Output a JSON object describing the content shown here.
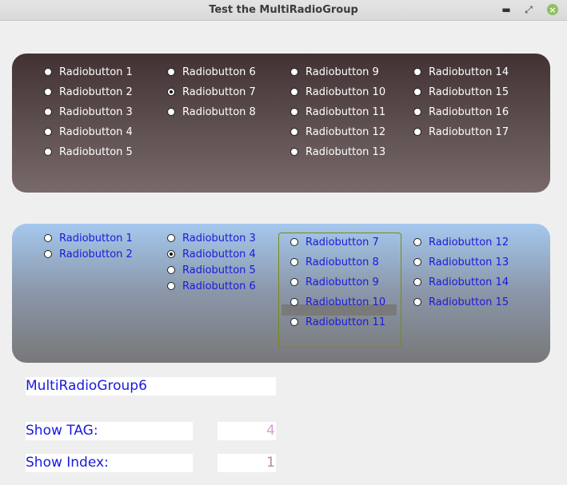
{
  "window": {
    "title": "Test the MultiRadioGroup"
  },
  "panel1": {
    "items": [
      {
        "label": "Radiobutton 1",
        "checked": false
      },
      {
        "label": "Radiobutton 2",
        "checked": false
      },
      {
        "label": "Radiobutton 3",
        "checked": false
      },
      {
        "label": "Radiobutton 4",
        "checked": false
      },
      {
        "label": "Radiobutton 5",
        "checked": false
      },
      {
        "label": "Radiobutton 6",
        "checked": false
      },
      {
        "label": "Radiobutton 7",
        "checked": true
      },
      {
        "label": "Radiobutton 8",
        "checked": false
      },
      {
        "label": "Radiobutton 9",
        "checked": false
      },
      {
        "label": "Radiobutton 10",
        "checked": false
      },
      {
        "label": "Radiobutton 11",
        "checked": false
      },
      {
        "label": "Radiobutton 12",
        "checked": false
      },
      {
        "label": "Radiobutton 13",
        "checked": false
      },
      {
        "label": "Radiobutton 14",
        "checked": false
      },
      {
        "label": "Radiobutton 15",
        "checked": false
      },
      {
        "label": "Radiobutton 16",
        "checked": false
      },
      {
        "label": "Radiobutton 17",
        "checked": false
      }
    ]
  },
  "panel2": {
    "items": [
      {
        "label": "Radiobutton 1",
        "checked": false
      },
      {
        "label": "Radiobutton 2",
        "checked": false
      },
      {
        "label": "Radiobutton 3",
        "checked": false
      },
      {
        "label": "Radiobutton 4",
        "checked": true
      },
      {
        "label": "Radiobutton 5",
        "checked": false
      },
      {
        "label": "Radiobutton 6",
        "checked": false
      },
      {
        "label": "Radiobutton 7",
        "checked": false
      },
      {
        "label": "Radiobutton 8",
        "checked": false
      },
      {
        "label": "Radiobutton 9",
        "checked": false
      },
      {
        "label": "Radiobutton 10",
        "checked": false,
        "highlighted": true
      },
      {
        "label": "Radiobutton 11",
        "checked": false
      },
      {
        "label": "Radiobutton 12",
        "checked": false
      },
      {
        "label": "Radiobutton 13",
        "checked": false
      },
      {
        "label": "Radiobutton 14",
        "checked": false
      },
      {
        "label": "Radiobutton 15",
        "checked": false
      }
    ]
  },
  "info": {
    "group_name": "MultiRadioGroup6",
    "tag_label": "Show TAG:",
    "tag_value": "4",
    "index_label": "Show Index:",
    "index_value": "1"
  },
  "colors": {
    "label_blue": "#1a1adc",
    "tag_value": "#d2a0d2",
    "index_value": "#b09090"
  }
}
